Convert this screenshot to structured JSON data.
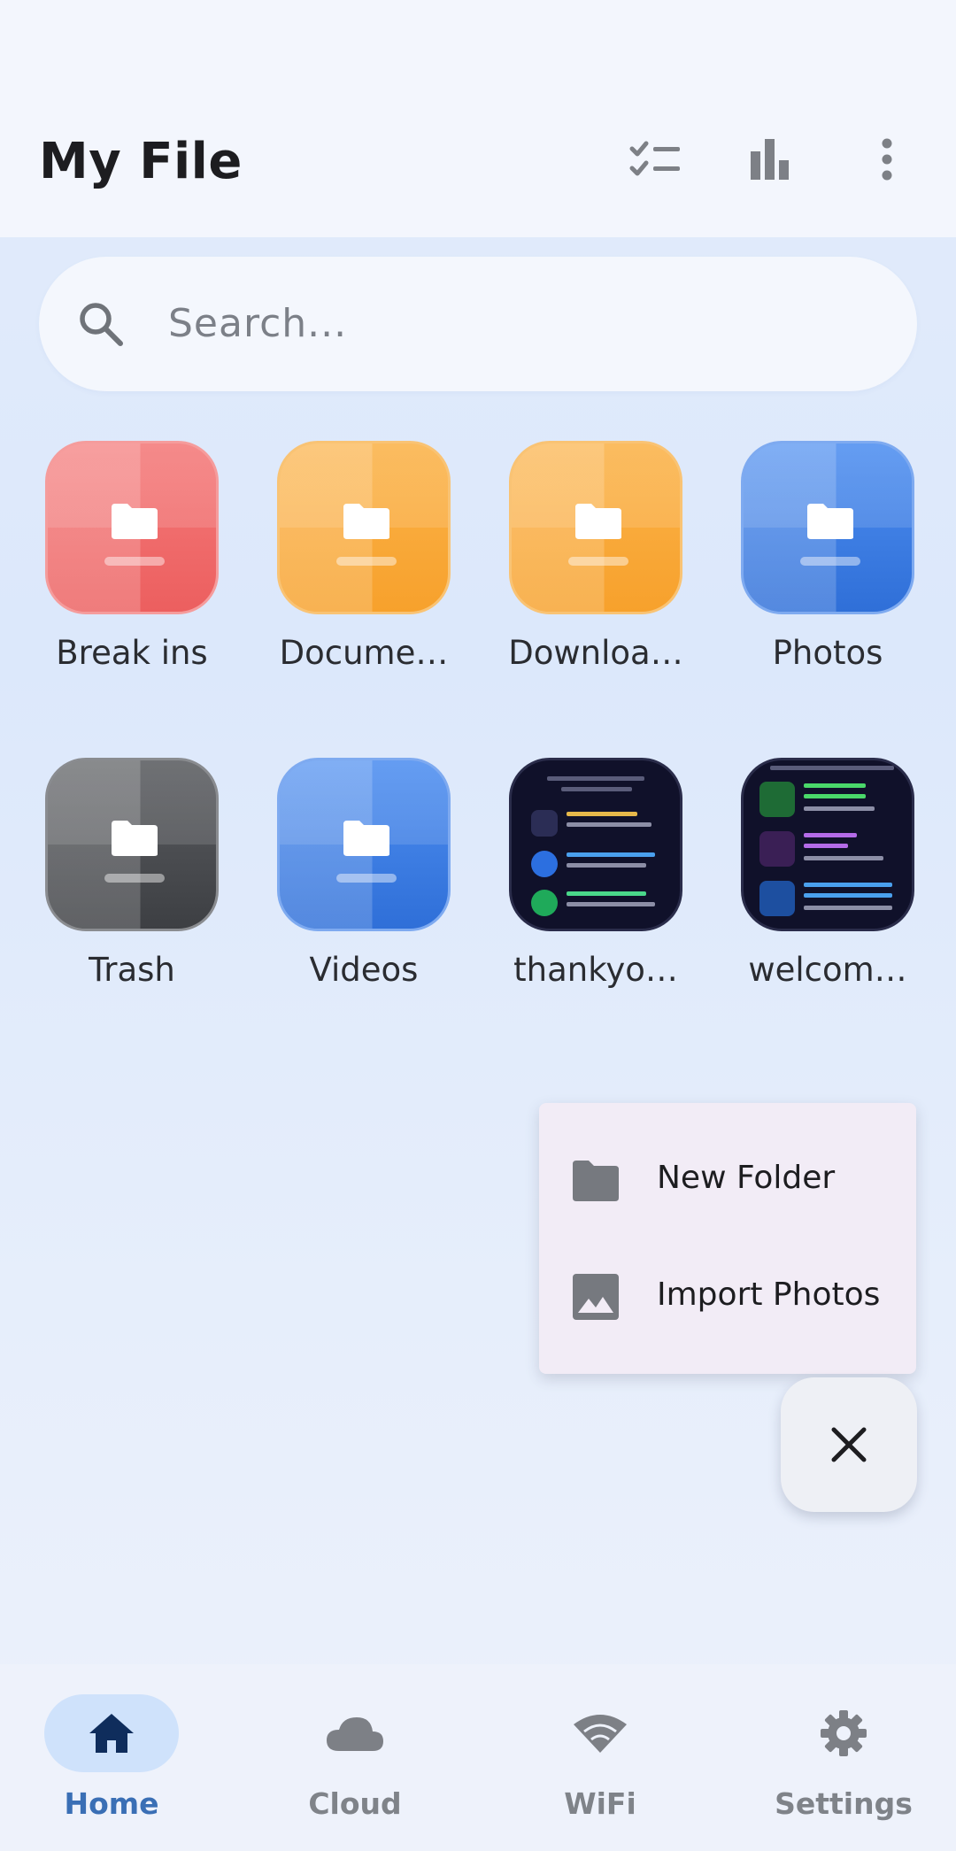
{
  "header": {
    "title": "My File",
    "actions": [
      {
        "name": "select-list-icon"
      },
      {
        "name": "bar-chart-icon"
      },
      {
        "name": "more-vert-icon"
      }
    ]
  },
  "search": {
    "placeholder": "Search..."
  },
  "folders": [
    {
      "label": "Break ins",
      "color": "red"
    },
    {
      "label": "Docume…",
      "color": "orange"
    },
    {
      "label": "Downloa…",
      "color": "orange"
    },
    {
      "label": "Photos",
      "color": "blue"
    },
    {
      "label": "Trash",
      "color": "gray"
    },
    {
      "label": "Videos",
      "color": "blue"
    },
    {
      "label": "thankyo…",
      "color": "thumbnail"
    },
    {
      "label": "welcom…",
      "color": "thumbnail"
    }
  ],
  "menu": {
    "new_folder": "New Folder",
    "import_photos": "Import Photos"
  },
  "fab": {
    "icon": "close-icon"
  },
  "nav": {
    "home": "Home",
    "cloud": "Cloud",
    "wifi": "WiFi",
    "settings": "Settings",
    "active": "Home"
  },
  "colors": {
    "accent": "#3a6fb5",
    "active_pill": "#cfe2fb",
    "active_icon": "#0f2d5c"
  }
}
